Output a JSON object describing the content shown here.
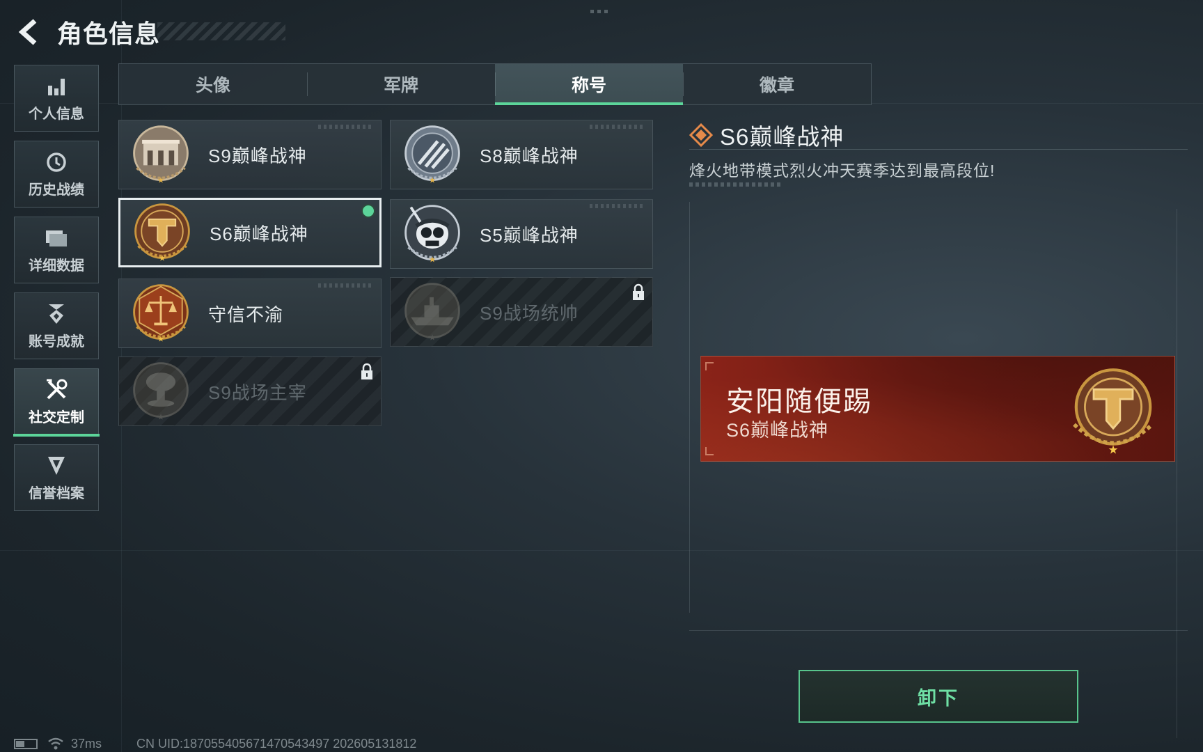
{
  "header": {
    "title": "角色信息",
    "back_icon": "back-arrow-icon"
  },
  "sidebar": {
    "items": [
      {
        "label": "个人信息",
        "icon": "bar-chart-icon",
        "active": false
      },
      {
        "label": "历史战绩",
        "icon": "history-clock-icon",
        "active": false
      },
      {
        "label": "详细数据",
        "icon": "folder-icon",
        "active": false
      },
      {
        "label": "账号成就",
        "icon": "medal-icon",
        "active": false
      },
      {
        "label": "社交定制",
        "icon": "tools-icon",
        "active": true
      },
      {
        "label": "信誉档案",
        "icon": "shield-badge-icon",
        "active": false
      }
    ]
  },
  "tabs": [
    {
      "label": "头像",
      "active": false
    },
    {
      "label": "军牌",
      "active": false
    },
    {
      "label": "称号",
      "active": true
    },
    {
      "label": "徽章",
      "active": false
    }
  ],
  "titles": [
    {
      "name": "S9巅峰战神",
      "emblem": "fortress-emblem-icon",
      "selected": false,
      "equipped": false,
      "locked": false
    },
    {
      "name": "S8巅峰战神",
      "emblem": "slash-emblem-icon",
      "selected": false,
      "equipped": false,
      "locked": false
    },
    {
      "name": "S6巅峰战神",
      "emblem": "t-emblem-icon",
      "selected": true,
      "equipped": true,
      "locked": false
    },
    {
      "name": "S5巅峰战神",
      "emblem": "skull-emblem-icon",
      "selected": false,
      "equipped": false,
      "locked": false
    },
    {
      "name": "守信不渝",
      "emblem": "scales-emblem-icon",
      "selected": false,
      "equipped": false,
      "locked": false
    },
    {
      "name": "S9战场统帅",
      "emblem": "warship-emblem-icon",
      "selected": false,
      "equipped": false,
      "locked": true
    },
    {
      "name": "S9战场主宰",
      "emblem": "mushroom-cloud-emblem-icon",
      "selected": false,
      "equipped": false,
      "locked": true
    }
  ],
  "detail": {
    "title": "S6巅峰战神",
    "description": "烽火地带模式烈火冲天赛季达到最高段位!",
    "icon": "diamond-rank-icon"
  },
  "nameplate": {
    "player_name": "安阳随便踢",
    "title": "S6巅峰战神",
    "emblem": "t-emblem-icon"
  },
  "unequip_label": "卸下",
  "status": {
    "ping": "37ms",
    "uid": "CN UID:1870554056714705434​97 202605131812"
  },
  "colors": {
    "accent": "#5cd59a",
    "nameplate": "#7a1f15",
    "gold": "#c9963f"
  }
}
